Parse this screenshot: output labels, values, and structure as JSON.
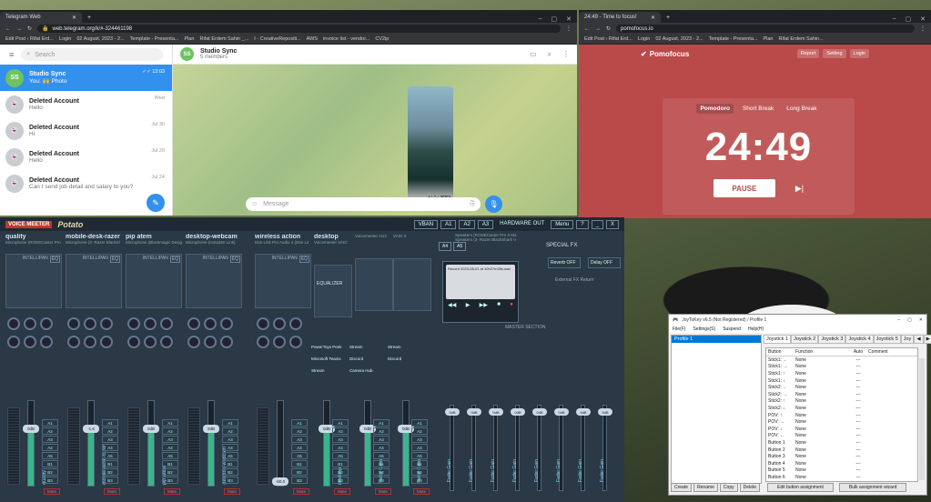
{
  "telegram": {
    "tab_title": "Telegram Web",
    "url": "web.telegram.org/k/#-324461198",
    "bookmarks": [
      "Edit Post ‹ Rifat Erd...",
      "Login",
      "02 August, 2023 - 2...",
      "Template - Presenta...",
      "Plan",
      "Rifat Erdem Sahin _...",
      "I - CreativeRepositi...",
      "AWS",
      "invoice list - vendor...",
      "CV2ip"
    ],
    "search_placeholder": "Search",
    "chats": [
      {
        "avatar": "SS",
        "name": "Studio Sync",
        "preview": "You: 🙌 Photo",
        "time": "✓✓ 13:03"
      },
      {
        "avatar": "",
        "name": "Deleted Account",
        "preview": "Hello",
        "time": "Wed"
      },
      {
        "avatar": "",
        "name": "Deleted Account",
        "preview": "Hi",
        "time": "Jul 30"
      },
      {
        "avatar": "",
        "name": "Deleted Account",
        "preview": "Hello",
        "time": "Jul 29"
      },
      {
        "avatar": "",
        "name": "Deleted Account",
        "preview": "Can I send job detail and salary to you?",
        "time": "Jul 24"
      }
    ],
    "chat_header": {
      "avatar": "SS",
      "title": "Studio Sync",
      "subtitle": "5 members"
    },
    "photo_time": "13:03 ✓✓",
    "message_placeholder": "Message"
  },
  "pomofocus": {
    "tab_title": "24:49 - Time to focus!",
    "url": "pomofocus.io",
    "bookmarks": [
      "Edit Post ‹ Rifat Erd...",
      "Login",
      "02 August, 2023 - 2...",
      "Template - Presenta...",
      "Plan",
      "Rifat Erdem Sahin..."
    ],
    "logo": "Pomofocus",
    "nav": [
      "Report",
      "Setting",
      "Login"
    ],
    "tabs": [
      "Pomodoro",
      "Short Break",
      "Long Break"
    ],
    "time": "24:49",
    "action": "PAUSE",
    "skip_icon": "▶|"
  },
  "voicemeeter": {
    "logo": "VOICE MEETER",
    "edition": "Potato",
    "vban": "VBAN",
    "menu": "Menu",
    "hardware_out": "HARDWARE OUT",
    "hw_devices": [
      "Speakers (RODECaster Pro II Ma",
      "Speakers (2- Razer BlackShark V"
    ],
    "buses_a": [
      "A1",
      "A2",
      "A3",
      "A4",
      "A5"
    ],
    "strips": [
      {
        "name": "quality",
        "device": "Microphone (RODECaster Pro",
        "gain": "0dB",
        "label": "quality"
      },
      {
        "name": "mobile-desk-razer",
        "device": "Microphone (2- Razer BlackSl",
        "gain": "-1.6",
        "label": "mobile-desk-razer"
      },
      {
        "name": "pip atem",
        "device": "Microphone (Blackmagic Desig",
        "gain": "0dB",
        "label": "pip atem"
      },
      {
        "name": "desktop-webcam",
        "device": "Microphone (Insta360 Link)",
        "gain": "0dB",
        "label": "desktop-webcam"
      },
      {
        "name": "wireless action",
        "device": "Dan Link Pro Audio 4 (Dan Lir",
        "gain": "-60.0",
        "label": ""
      },
      {
        "name": "desktop",
        "device": "Voicemeeter VAIO",
        "gain": "0dB",
        "label": "desktop"
      },
      {
        "name": "",
        "device": "Voicemeeter AUX",
        "gain": "0dB",
        "label": "Fader Gain"
      },
      {
        "name": "",
        "device": "VAIO 3",
        "gain": "0dB",
        "label": "Fader Gain"
      }
    ],
    "equalizer": "EQUALIZER",
    "intellipan": "INTELLIPAN",
    "eq_tag": "EQ",
    "mute": "Mute",
    "special_fx": "SPECIAL FX",
    "reverb": "Reverb OFF",
    "delay": "Delay OFF",
    "external_fx": "External FX Return",
    "record_title": "Record 2023-08-01 at 10h27m35s.wav",
    "master_section": "MASTER SECTION",
    "outputs": [
      "0dB",
      "0dB",
      "0dB",
      "0dB",
      "0dB",
      "0dB",
      "0dB",
      "0dB"
    ],
    "output_label": "Fader Gain",
    "inserts": [
      "PowerToys Peek",
      "Stream",
      "Stream",
      "Microsoft Teams",
      "Discord",
      "Discord",
      "Stream",
      "Camera Hub"
    ]
  },
  "joytokey": {
    "title": "JoyToKey v6.5 (Not Registered) / Profile 1",
    "menu": [
      "File(F)",
      "Settings(S)",
      "Suspend",
      "Help(H)"
    ],
    "profiles": [
      "Profile 1"
    ],
    "tabs": [
      "Joystick 1",
      "Joystick 2",
      "Joystick 3",
      "Joystick 4",
      "Joystick 5",
      "Joy"
    ],
    "headers": [
      "Button",
      "Function",
      "Auto",
      "Comment"
    ],
    "rows": [
      [
        "Stick1: ←",
        "None",
        "---"
      ],
      [
        "Stick1: →",
        "None",
        "---"
      ],
      [
        "Stick1: ↑",
        "None",
        "---"
      ],
      [
        "Stick1: ↓",
        "None",
        "---"
      ],
      [
        "Stick2: ←",
        "None",
        "---"
      ],
      [
        "Stick2: →",
        "None",
        "---"
      ],
      [
        "Stick2: ↑",
        "None",
        "---"
      ],
      [
        "Stick2: ↓",
        "None",
        "---"
      ],
      [
        "POV: ↑",
        "None",
        "---"
      ],
      [
        "POV: →",
        "None",
        "---"
      ],
      [
        "POV: ↓",
        "None",
        "---"
      ],
      [
        "POV: ←",
        "None",
        "---"
      ],
      [
        "Button 1",
        "None",
        "---"
      ],
      [
        "Button 2",
        "None",
        "---"
      ],
      [
        "Button 3",
        "None",
        "---"
      ],
      [
        "Button 4",
        "None",
        "---"
      ],
      [
        "Button 5",
        "None",
        "---"
      ],
      [
        "Button 6",
        "None",
        "---"
      ]
    ],
    "left_buttons": [
      "Create",
      "Rename",
      "Copy",
      "Delete"
    ],
    "right_buttons": [
      "Edit button assignment",
      "Bulk assignment wizard"
    ]
  },
  "colors": {
    "telegram_accent": "#3390ec",
    "pomofocus_bg": "#ba4949",
    "voicemeeter_bg": "#2b3845",
    "fader_fill": "#39b58a"
  }
}
